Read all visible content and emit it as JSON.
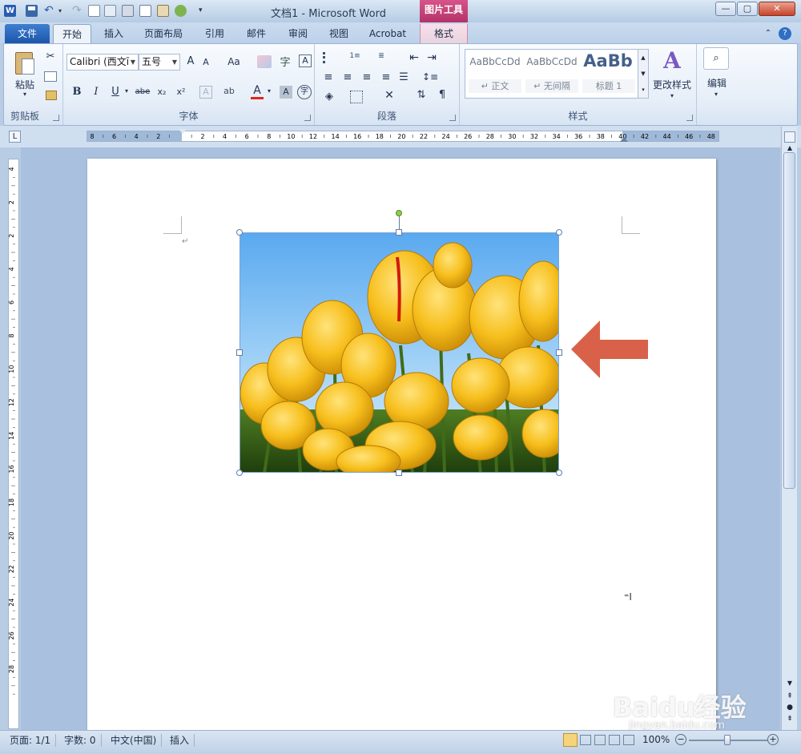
{
  "window": {
    "title": "文档1 - Microsoft Word",
    "contextual_group": "图片工具",
    "controls": {
      "minimize": "—",
      "maximize": "▢",
      "close": "✕"
    }
  },
  "tabs": [
    {
      "label": "文件",
      "active": false
    },
    {
      "label": "开始",
      "active": true
    },
    {
      "label": "插入"
    },
    {
      "label": "页面布局"
    },
    {
      "label": "引用"
    },
    {
      "label": "邮件"
    },
    {
      "label": "审阅"
    },
    {
      "label": "视图"
    },
    {
      "label": "Acrobat"
    },
    {
      "label": "格式"
    }
  ],
  "ribbon": {
    "clipboard": {
      "paste_label": "粘贴",
      "group_label": "剪贴板"
    },
    "font": {
      "font_name": "Calibri (西文ī",
      "font_size": "五号",
      "grow": "A",
      "shrink": "A",
      "case": "Aa",
      "bold": "B",
      "italic": "I",
      "underline": "U",
      "strikethrough": "abe",
      "subscript": "x₂",
      "superscript": "x²",
      "font_color": "A",
      "group_label": "字体"
    },
    "paragraph": {
      "group_label": "段落"
    },
    "styles": {
      "items": [
        {
          "sample": "AaBbCcDd",
          "name": "↵ 正文"
        },
        {
          "sample": "AaBbCcDd",
          "name": "↵ 无间隔"
        },
        {
          "sample": "AaBb",
          "name": "标题 1"
        }
      ],
      "change_styles": "更改样式",
      "group_label": "样式"
    },
    "editing": {
      "label": "编辑"
    }
  },
  "ruler": {
    "top_numbers": [
      "8",
      "6",
      "4",
      "2",
      "",
      "2",
      "4",
      "6",
      "8",
      "10",
      "12",
      "14",
      "16",
      "18",
      "20",
      "22",
      "24",
      "26",
      "28",
      "30",
      "32",
      "34",
      "36",
      "38",
      "40",
      "42",
      "44",
      "46",
      "48"
    ],
    "left_numbers": [
      "4",
      "2",
      "2",
      "4",
      "6",
      "8",
      "10",
      "12",
      "14",
      "16",
      "18",
      "20",
      "22",
      "24",
      "26",
      "28"
    ]
  },
  "document": {
    "paragraph_mark": "↵",
    "picture_description": "yellow tulips under blue sky",
    "arrow_color": "#d9614a"
  },
  "status": {
    "page": "页面: 1/1",
    "words": "字数: 0",
    "language": "中文(中国)",
    "mode": "插入",
    "zoom": "100%"
  },
  "watermark": {
    "logo": "Baidu经验",
    "url": "jingyan.baidu.com"
  },
  "colors": {
    "file_tab": "#2a63b8",
    "contextual": "#c2407a",
    "page": "#ffffff",
    "workspace": "#a9c1de"
  }
}
